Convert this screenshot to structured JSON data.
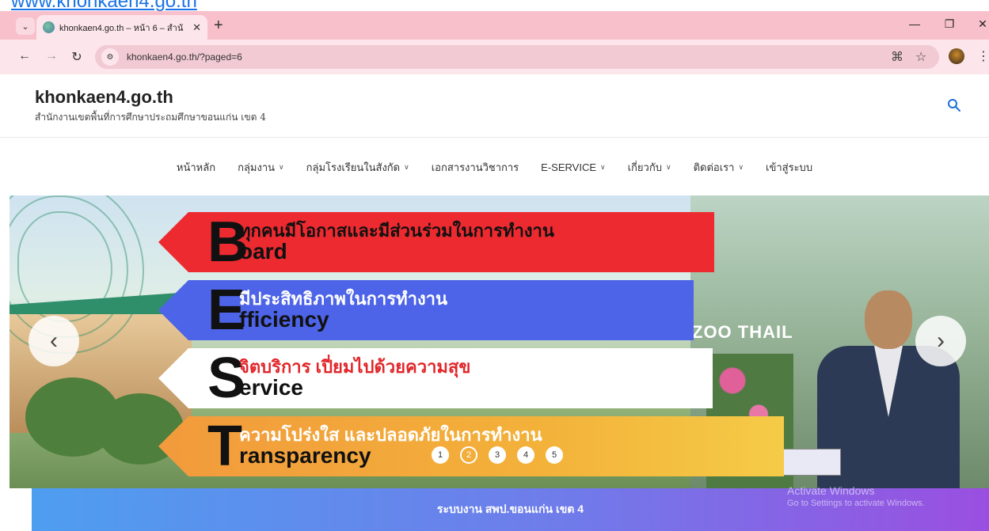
{
  "top_link": "www.khonkaen4.go.th",
  "browser": {
    "tab_title": "khonkaen4.go.th – หน้า 6 – สำนั",
    "url": "khonkaen4.go.th/?paged=6"
  },
  "site": {
    "title": "khonkaen4.go.th",
    "description": "สำนักงานเขตพื้นที่การศึกษาประถมศึกษาขอนแก่น เขต 4"
  },
  "nav": {
    "items": [
      {
        "label": "หน้าหลัก",
        "has_dropdown": false
      },
      {
        "label": "กลุ่มงาน",
        "has_dropdown": true
      },
      {
        "label": "กลุ่มโรงเรียนในสังกัด",
        "has_dropdown": true
      },
      {
        "label": "เอกสารงานวิชาการ",
        "has_dropdown": false
      },
      {
        "label": "E-SERVICE",
        "has_dropdown": true
      },
      {
        "label": "เกี่ยวกับ",
        "has_dropdown": true
      },
      {
        "label": "ติดต่อเรา",
        "has_dropdown": true
      },
      {
        "label": "เข้าสู่ระบบ",
        "has_dropdown": false
      }
    ]
  },
  "slider": {
    "banners": [
      {
        "letter": "B",
        "thai": "ทุกคนมีโอกาสและมีส่วนร่วมในการทำงาน",
        "eng": "oard"
      },
      {
        "letter": "E",
        "thai": "มีประสิทธิภาพในการทำงาน",
        "eng": "fficiency"
      },
      {
        "letter": "S",
        "thai": "จิตบริการ เปี่ยมไปด้วยความสุข",
        "eng": "ervice"
      },
      {
        "letter": "T",
        "thai": "ความโปร่งใส และปลอดภัยในการทำงาน",
        "eng": "ransparency"
      }
    ],
    "photo_sign": "ZOO THAIL",
    "pagination": [
      "1",
      "2",
      "3",
      "4",
      "5"
    ],
    "active_slide": 2
  },
  "footer": {
    "text": "ระบบงาน สพป.ขอนแก่น เขต 4"
  },
  "watermark": {
    "line1": "Activate Windows",
    "line2": "Go to Settings to activate Windows."
  }
}
